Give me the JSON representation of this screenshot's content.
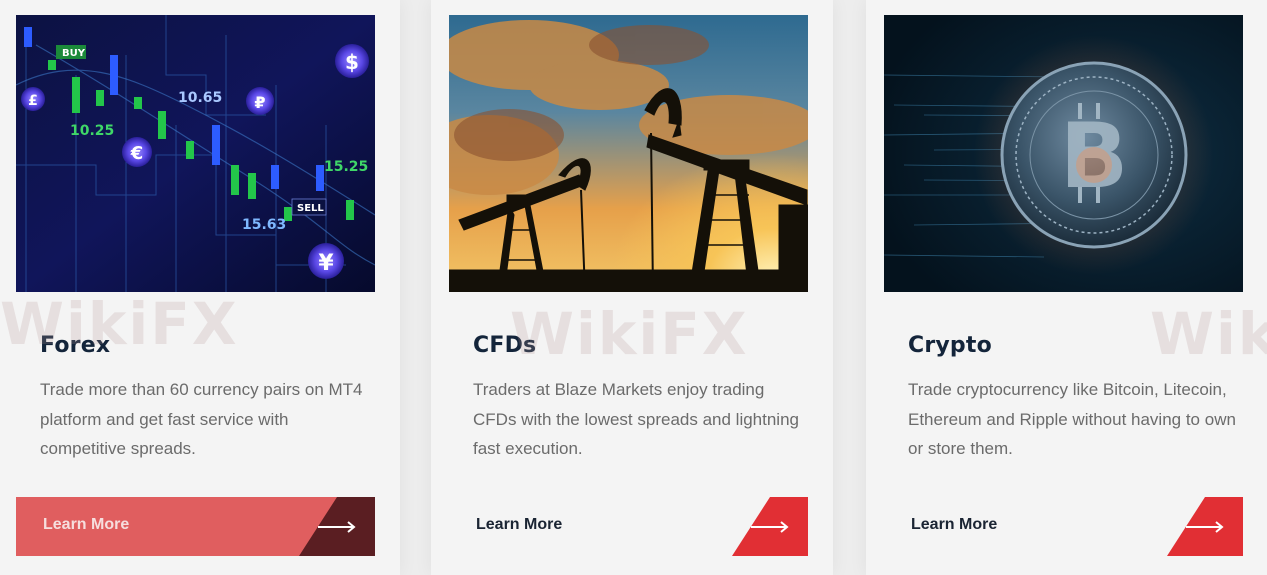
{
  "cards": [
    {
      "title": "Forex",
      "description": "Trade more than 60 currency pairs on MT4 platform and get fast service with competitive spreads.",
      "cta_label": "Learn More",
      "image_labels": [
        "BUY",
        "10.65",
        "10.25",
        "15.25",
        "SELL",
        "15.63",
        "£",
        "$",
        "₽",
        "€",
        "¥"
      ]
    },
    {
      "title": "CFDs",
      "description": "Traders at Blaze Markets enjoy trading CFDs with the lowest spreads and lightning fast execution.",
      "cta_label": "Learn More"
    },
    {
      "title": "Crypto",
      "description": "Trade cryptocurrency like Bitcoin, Litecoin, Ethereum and Ripple without having to own or store them.",
      "cta_label": "Learn More"
    }
  ],
  "watermark": "WikiFX",
  "colors": {
    "accent_red": "#e12f34",
    "accent_red_soft": "#e05e5f",
    "dark_tab": "#5a1e22",
    "title_text": "#13243a",
    "body_text": "#6b6b6b"
  },
  "icons": [
    "arrow-right-icon",
    "bitcoin-coin-icon",
    "oil-pump-icon",
    "currency-chart-icon"
  ]
}
